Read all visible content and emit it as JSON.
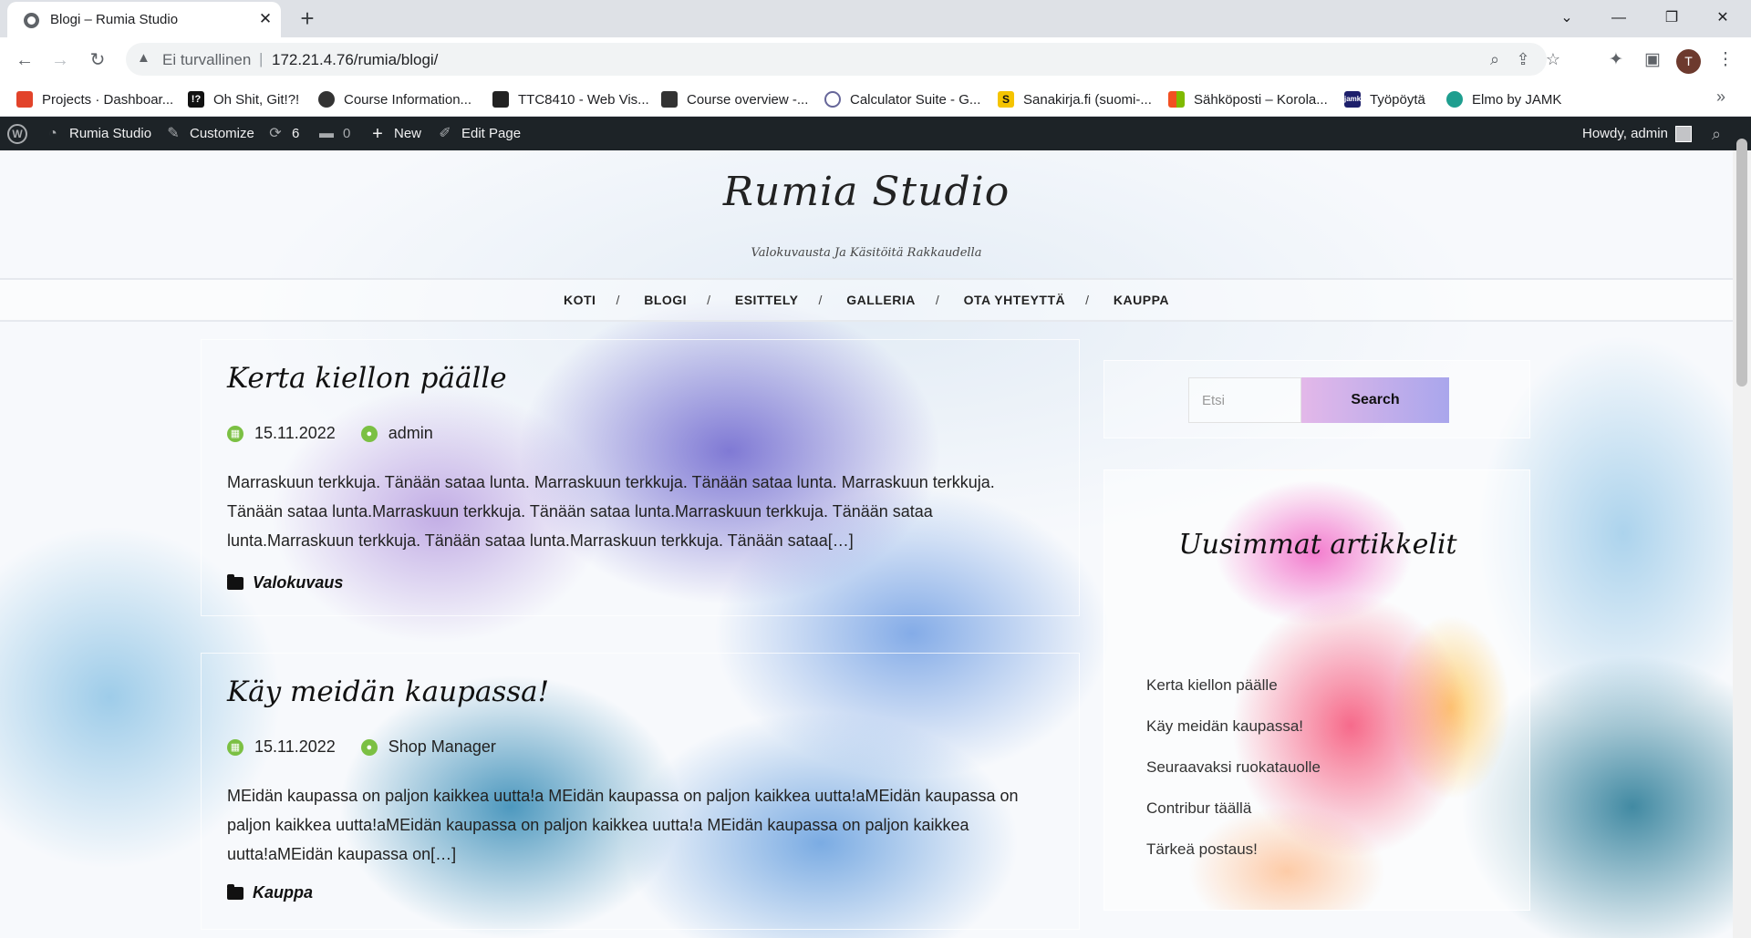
{
  "browser": {
    "tab_title": "Blogi – Rumia Studio",
    "security_label": "Ei turvallinen",
    "url": "172.21.4.76/rumia/blogi/",
    "profile_initial": "T",
    "bookmarks": [
      {
        "label": "Projects · Dashboar...",
        "icon": "gitlab-icon",
        "color": "#e2432a"
      },
      {
        "label": "Oh Shit, Git!?!",
        "icon": "ohshitgit-icon",
        "color": "#111111"
      },
      {
        "label": "Course Information...",
        "icon": "course-icon",
        "color": "#333333"
      },
      {
        "label": "TTC8410 - Web Vis...",
        "icon": "graduation-cap-icon",
        "color": "#222222"
      },
      {
        "label": "Course overview -...",
        "icon": "book-icon",
        "color": "#333333"
      },
      {
        "label": "Calculator Suite - G...",
        "icon": "geogebra-icon",
        "color": "#666699"
      },
      {
        "label": "Sanakirja.fi (suomi-...",
        "icon": "sanakirja-icon",
        "color": "#f5c400"
      },
      {
        "label": "Sähköposti – Korola...",
        "icon": "microsoft-icon",
        "color": "#f25022"
      },
      {
        "label": "Työpöytä",
        "icon": "jamk-icon",
        "color": "#1d1f6b"
      },
      {
        "label": "Elmo by JAMK",
        "icon": "elmo-icon",
        "color": "#1e9e8f"
      }
    ]
  },
  "adminbar": {
    "site_name": "Rumia Studio",
    "customize": "Customize",
    "updates": "6",
    "comments": "0",
    "new": "New",
    "edit_page": "Edit Page",
    "howdy": "Howdy, admin"
  },
  "site": {
    "title": "Rumia Studio",
    "tagline": "Valokuvausta Ja Käsitöitä Rakkaudella",
    "menu": [
      "KOTI",
      "BLOGI",
      "ESITTELY",
      "GALLERIA",
      "OTA YHTEYTTÄ",
      "KAUPPA"
    ]
  },
  "posts": [
    {
      "title": "Kerta kiellon päälle",
      "date": "15.11.2022",
      "author": "admin",
      "excerpt": "Marraskuun terkkuja. Tänään sataa lunta. Marraskuun terkkuja. Tänään sataa lunta. Marraskuun terkkuja. Tänään sataa lunta.Marraskuun terkkuja. Tänään sataa lunta.Marraskuun terkkuja. Tänään sataa lunta.Marraskuun terkkuja. Tänään sataa lunta.Marraskuun terkkuja. Tänään sataa[…]",
      "category": "Valokuvaus"
    },
    {
      "title": "Käy meidän kaupassa!",
      "date": "15.11.2022",
      "author": "Shop Manager",
      "excerpt": "MEidän kaupassa on paljon kaikkea uutta!a MEidän kaupassa on paljon kaikkea uutta!aMEidän kaupassa on paljon kaikkea uutta!aMEidän kaupassa on paljon kaikkea uutta!a MEidän kaupassa on paljon kaikkea uutta!aMEidän kaupassa on[…]",
      "category": "Kauppa"
    }
  ],
  "sidebar": {
    "search_placeholder": "Etsi",
    "search_button": "Search",
    "recent_title": "Uusimmat artikkelit",
    "recent_items": [
      "Kerta kiellon päälle",
      "Käy meidän kaupassa!",
      "Seuraavaksi ruokatauolle",
      "Contribur täällä",
      "Tärkeä postaus!"
    ]
  }
}
